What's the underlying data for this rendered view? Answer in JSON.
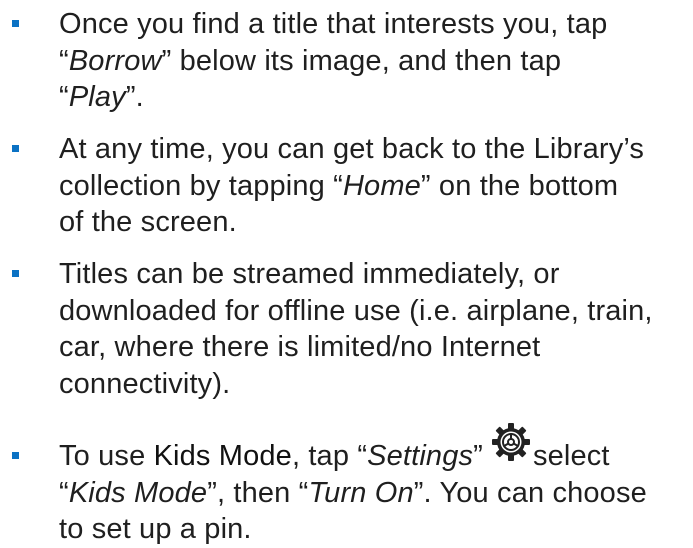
{
  "accent_color": "#0b72c4",
  "bullets": [
    {
      "lines": [
        [
          "Once you find a title that interests you, tap"
        ],
        [
          "“",
          "Borrow",
          "” below its image, and then tap"
        ],
        [
          "“",
          "Play",
          "”."
        ]
      ]
    },
    {
      "lines": [
        [
          "At any time, you can get back to the Library’s"
        ],
        [
          "collection by tapping “",
          "Home",
          "” on the bottom"
        ],
        [
          "of the screen."
        ]
      ]
    },
    {
      "lines": [
        [
          "Titles can be streamed immediately, or"
        ],
        [
          "downloaded for offline use (i.e. airplane, train,"
        ],
        [
          "car, where there is limited/no Internet"
        ],
        [
          "connectivity)."
        ]
      ]
    },
    {
      "line1": {
        "pre": "To use ",
        "strong": "Kids Mode",
        "mid": ", tap “",
        "em": "Settings",
        "post": "”",
        "icon": "gear-icon",
        "after": "select"
      },
      "line2": [
        "“",
        "Kids Mode",
        "”, then “",
        "Turn On",
        "”. You can choose"
      ],
      "line3": "to set up a pin."
    }
  ]
}
